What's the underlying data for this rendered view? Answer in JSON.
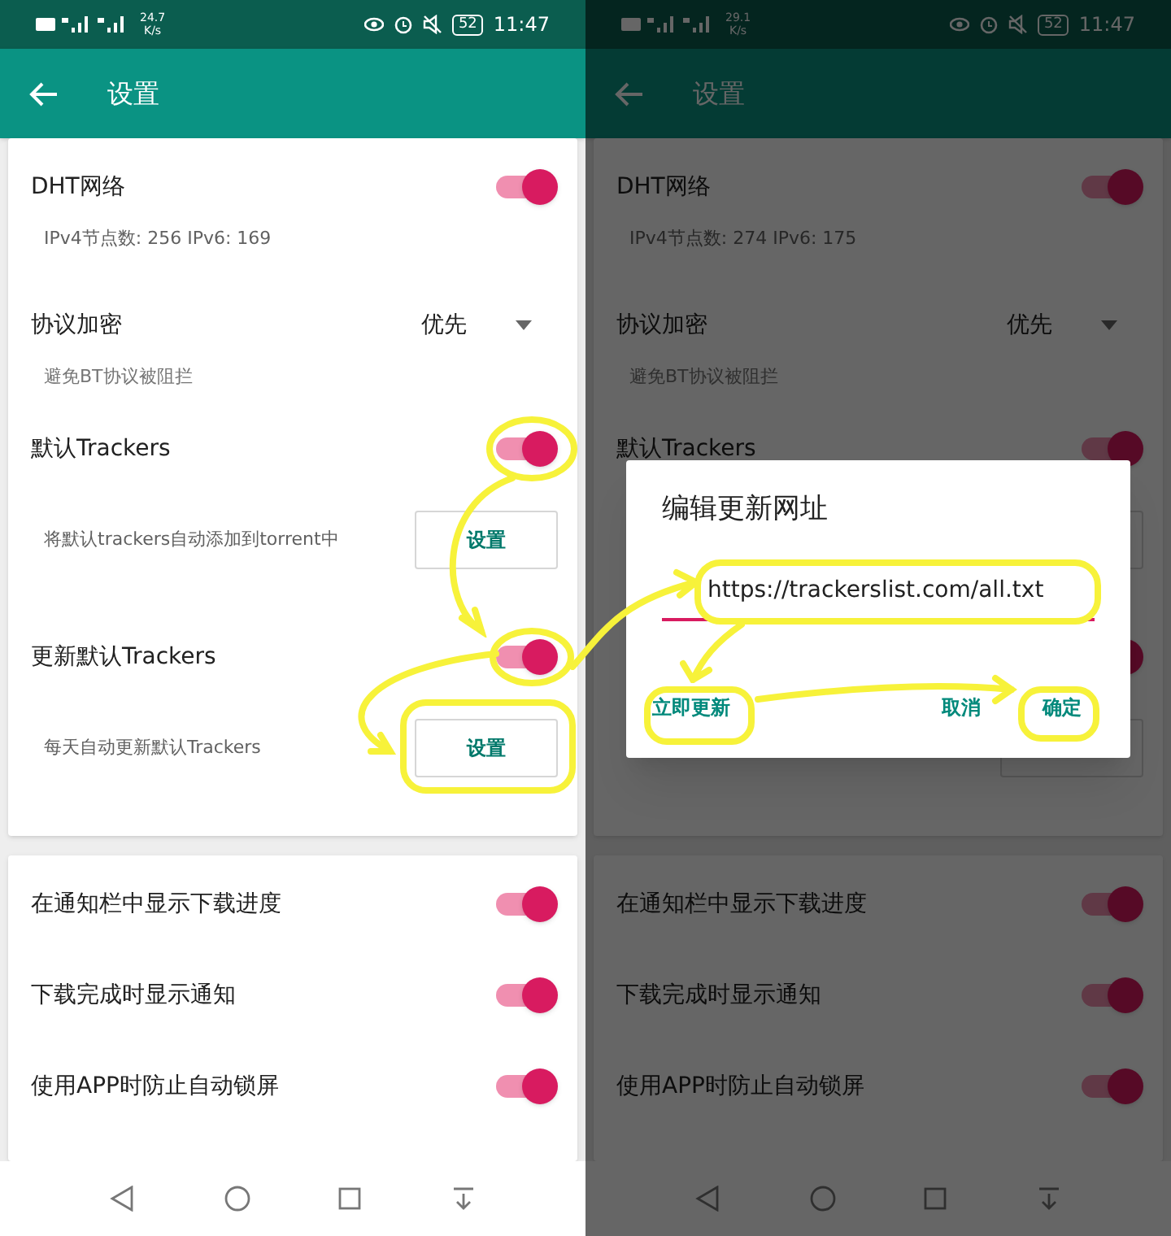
{
  "screens": [
    {
      "status_bar": {
        "speed_value": "24.7",
        "speed_unit": "K/s",
        "battery": "52",
        "time": "11:47"
      },
      "app_bar": {
        "title": "设置"
      },
      "cards": [
        {
          "items": [
            {
              "kind": "toggle",
              "title": "DHT网络",
              "subtitle": "IPv4节点数: 256 IPv6:  169",
              "on": true
            },
            {
              "kind": "dropdown",
              "title": "协议加密",
              "value": "优先",
              "subtitle": "避免BT协议被阻拦"
            },
            {
              "kind": "toggle",
              "title": "默认Trackers",
              "on": true
            },
            {
              "kind": "button-row",
              "subtitle": "将默认trackers自动添加到torrent中",
              "button_label": "设置"
            },
            {
              "kind": "toggle",
              "title": "更新默认Trackers",
              "on": true
            },
            {
              "kind": "button-row",
              "subtitle": "每天自动更新默认Trackers",
              "button_label": "设置"
            }
          ]
        },
        {
          "items": [
            {
              "kind": "toggle",
              "title": "在通知栏中显示下载进度",
              "on": true
            },
            {
              "kind": "toggle",
              "title": "下载完成时显示通知",
              "on": true
            },
            {
              "kind": "toggle",
              "title": "使用APP时防止自动锁屏",
              "on": true
            }
          ]
        }
      ]
    },
    {
      "status_bar": {
        "speed_value": "29.1",
        "speed_unit": "K/s",
        "battery": "52",
        "time": "11:47"
      },
      "app_bar": {
        "title": "设置"
      },
      "cards": [
        {
          "items": [
            {
              "kind": "toggle",
              "title": "DHT网络",
              "subtitle": "IPv4节点数: 274 IPv6:  175",
              "on": true
            },
            {
              "kind": "dropdown",
              "title": "协议加密",
              "value": "优先",
              "subtitle": "避免BT协议被阻拦"
            },
            {
              "kind": "toggle",
              "title": "默认Trackers",
              "on": true
            },
            {
              "kind": "button-row"
            },
            {
              "kind": "toggle",
              "on": true
            },
            {
              "kind": "button-row"
            }
          ]
        },
        {
          "items": [
            {
              "kind": "toggle",
              "title": "在通知栏中显示下载进度",
              "on": true
            },
            {
              "kind": "toggle",
              "title": "下载完成时显示通知",
              "on": true
            },
            {
              "kind": "toggle",
              "title": "使用APP时防止自动锁屏",
              "on": true
            }
          ]
        }
      ],
      "dialog": {
        "title": "编辑更新网址",
        "url": "https://trackerslist.com/all.txt",
        "buttons": [
          {
            "label": "立即更新"
          },
          {
            "label": "取消"
          },
          {
            "label": "确定"
          }
        ]
      }
    }
  ]
}
